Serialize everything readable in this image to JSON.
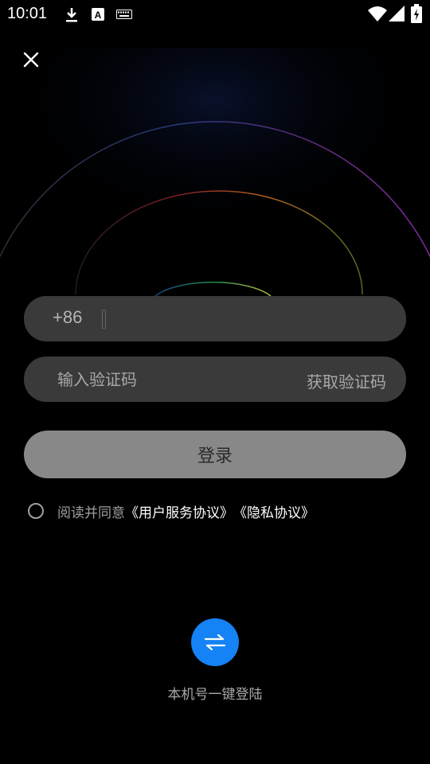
{
  "status_bar": {
    "time": "10:01",
    "left_icons": [
      "download-icon",
      "a-box-icon",
      "keyboard-icon"
    ],
    "right_icons": [
      "wifi-icon",
      "signal-icon",
      "battery-icon"
    ]
  },
  "header": {
    "close_icon": "close-icon"
  },
  "phone": {
    "prefix": "+86",
    "value": "",
    "placeholder": ""
  },
  "code": {
    "placeholder": "输入验证码",
    "get_code_label": "获取验证码"
  },
  "login": {
    "label": "登录"
  },
  "agreement": {
    "prefix_text": "阅读并同意",
    "user_agreement": "《用户服务协议》",
    "privacy": "《隐私协议》"
  },
  "one_key": {
    "icon": "swap-arrows-icon",
    "label": "本机号一键登陆"
  },
  "colors": {
    "accent": "#1582f5",
    "field_bg": "#3a3a3a",
    "button_bg": "#888888"
  }
}
